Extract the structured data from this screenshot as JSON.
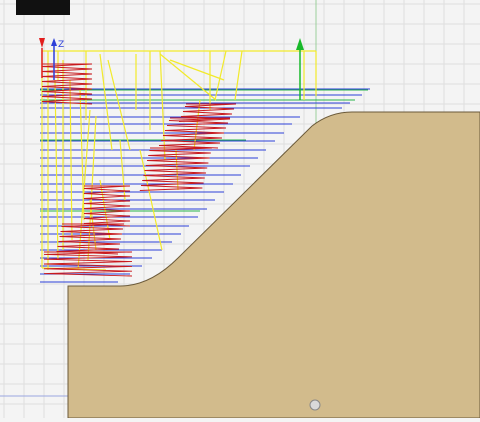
{
  "viewport": {
    "background": "#f4f4f4",
    "grid_color": "#dedede"
  },
  "axis_triad": {
    "z_label": "Z"
  },
  "colors": {
    "stock": "#d2bb8c",
    "stock_edge": "#6b5a3a",
    "rapid": "#f2ea2a",
    "cut": "#c8191e",
    "pass_blue": "#2d3fd9",
    "pass_green": "#27b54a"
  },
  "icons": {
    "axis_x_arrow": "red-arrow-down-icon",
    "axis_z_arrow": "blue-arrow-icon",
    "axis_y_arrow": "green-arrow-up-icon",
    "bottom_marker": "target-circle-icon"
  }
}
